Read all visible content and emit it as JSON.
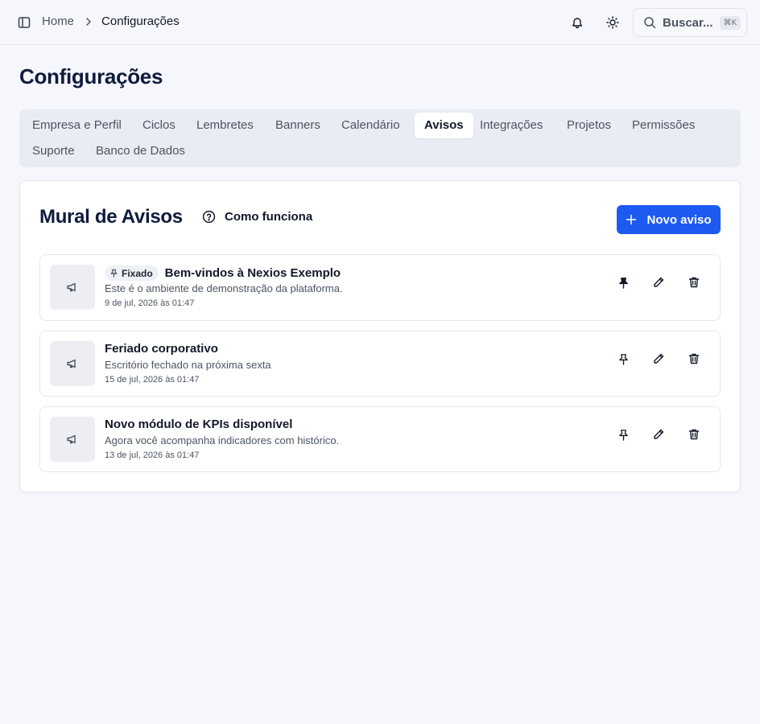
{
  "header": {
    "breadcrumb_home": "Home",
    "breadcrumb_current": "Configurações",
    "search_label": "Buscar...",
    "search_shortcut": "⌘K"
  },
  "page": {
    "title": "Configurações"
  },
  "tabs": [
    {
      "label": "Empresa e Perfil",
      "active": false
    },
    {
      "label": "Ciclos",
      "active": false
    },
    {
      "label": "Lembretes",
      "active": false
    },
    {
      "label": "Banners",
      "active": false
    },
    {
      "label": "Calendário",
      "active": false
    },
    {
      "label": "Avisos",
      "active": true
    },
    {
      "label": "Integrações",
      "active": false
    },
    {
      "label": "Projetos",
      "active": false
    },
    {
      "label": "Permissões",
      "active": false
    },
    {
      "label": "Suporte",
      "active": false
    },
    {
      "label": "Banco de Dados",
      "active": false
    }
  ],
  "board": {
    "title": "Mural de Avisos",
    "how_it_works": "Como funciona",
    "new_button": "Novo aviso",
    "pinned_badge": "Fixado"
  },
  "notices": [
    {
      "title": "Bem-vindos à Nexios Exemplo",
      "description": "Este é o ambiente de demonstração da plataforma.",
      "date": "9 de jul, 2026 às 01:47",
      "pinned": true
    },
    {
      "title": "Feriado corporativo",
      "description": "Escritório fechado na próxima sexta",
      "date": "15 de jul, 2026 às 01:47",
      "pinned": false
    },
    {
      "title": "Novo módulo de KPIs disponível",
      "description": "Agora você acompanha indicadores com histórico.",
      "date": "13 de jul, 2026 às 01:47",
      "pinned": false
    }
  ],
  "colors": {
    "accent": "#1d5af2",
    "background": "#f6f7fc",
    "tab_bar": "#e9ecf3"
  }
}
